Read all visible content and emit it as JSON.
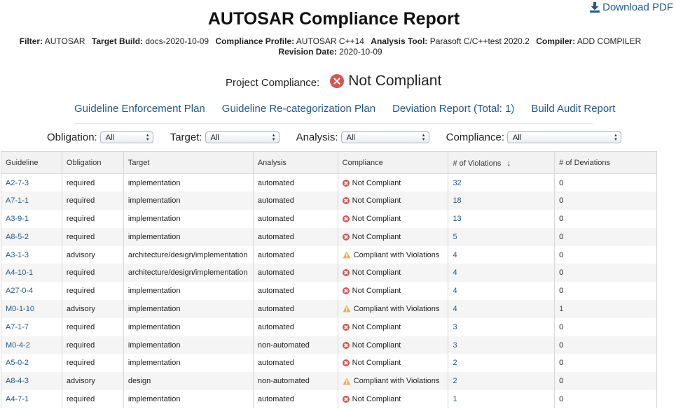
{
  "header": {
    "download_label": "Download PDF",
    "title": "AUTOSAR Compliance Report"
  },
  "meta": {
    "filter_label": "Filter:",
    "filter_value": "AUTOSAR",
    "build_label": "Target Build:",
    "build_value": "docs-2020-10-09",
    "profile_label": "Compliance Profile:",
    "profile_value": "AUTOSAR C++14",
    "tool_label": "Analysis Tool:",
    "tool_value": "Parasoft C/C++test 2020.2",
    "compiler_label": "Compiler:",
    "compiler_value": "ADD COMPILER",
    "revision_label": "Revision Date:",
    "revision_value": "2020-10-09"
  },
  "project": {
    "label": "Project Compliance:",
    "status": "Not Compliant",
    "status_color": "#d9534f"
  },
  "links": [
    "Guideline Enforcement Plan",
    "Guideline Re-categorization Plan",
    "Deviation Report (Total: 1)",
    "Build Audit Report"
  ],
  "filters": [
    {
      "label": "Obligation:",
      "value": "All"
    },
    {
      "label": "Target:",
      "value": "All"
    },
    {
      "label": "Analysis:",
      "value": "All"
    },
    {
      "label": "Compliance:",
      "value": "All"
    }
  ],
  "table": {
    "headers": [
      "Guideline",
      "Obligation",
      "Target",
      "Analysis",
      "Compliance",
      "# of Violations",
      "# of Deviations"
    ],
    "rows": [
      {
        "guideline": "A2-7-3",
        "obligation": "required",
        "target": "implementation",
        "analysis": "automated",
        "compliance": "Not Compliant",
        "status_icon": "error-icon",
        "violations": "32",
        "deviations": "0"
      },
      {
        "guideline": "A7-1-1",
        "obligation": "required",
        "target": "implementation",
        "analysis": "automated",
        "compliance": "Not Compliant",
        "status_icon": "error-icon",
        "violations": "18",
        "deviations": "0"
      },
      {
        "guideline": "A3-9-1",
        "obligation": "required",
        "target": "implementation",
        "analysis": "automated",
        "compliance": "Not Compliant",
        "status_icon": "error-icon",
        "violations": "13",
        "deviations": "0"
      },
      {
        "guideline": "A8-5-2",
        "obligation": "required",
        "target": "implementation",
        "analysis": "automated",
        "compliance": "Not Compliant",
        "status_icon": "error-icon",
        "violations": "5",
        "deviations": "0"
      },
      {
        "guideline": "A3-1-3",
        "obligation": "advisory",
        "target": "architecture/design/implementation",
        "analysis": "automated",
        "compliance": "Compliant with Violations",
        "status_icon": "warning-icon",
        "violations": "4",
        "deviations": "0"
      },
      {
        "guideline": "A4-10-1",
        "obligation": "required",
        "target": "architecture/design/implementation",
        "analysis": "automated",
        "compliance": "Not Compliant",
        "status_icon": "error-icon",
        "violations": "4",
        "deviations": "0"
      },
      {
        "guideline": "A27-0-4",
        "obligation": "required",
        "target": "implementation",
        "analysis": "automated",
        "compliance": "Not Compliant",
        "status_icon": "error-icon",
        "violations": "4",
        "deviations": "0"
      },
      {
        "guideline": "M0-1-10",
        "obligation": "advisory",
        "target": "implementation",
        "analysis": "automated",
        "compliance": "Compliant with Violations",
        "status_icon": "warning-icon",
        "violations": "4",
        "deviations": "1",
        "deviation_link": true
      },
      {
        "guideline": "A7-1-7",
        "obligation": "required",
        "target": "implementation",
        "analysis": "automated",
        "compliance": "Not Compliant",
        "status_icon": "error-icon",
        "violations": "3",
        "deviations": "0"
      },
      {
        "guideline": "M0-4-2",
        "obligation": "required",
        "target": "implementation",
        "analysis": "non-automated",
        "compliance": "Not Compliant",
        "status_icon": "error-icon",
        "violations": "3",
        "deviations": "0"
      },
      {
        "guideline": "A5-0-2",
        "obligation": "required",
        "target": "implementation",
        "analysis": "automated",
        "compliance": "Not Compliant",
        "status_icon": "error-icon",
        "violations": "2",
        "deviations": "0"
      },
      {
        "guideline": "A8-4-3",
        "obligation": "advisory",
        "target": "design",
        "analysis": "non-automated",
        "compliance": "Compliant with Violations",
        "status_icon": "warning-icon",
        "violations": "2",
        "deviations": "0"
      },
      {
        "guideline": "A4-7-1",
        "obligation": "required",
        "target": "implementation",
        "analysis": "automated",
        "compliance": "Not Compliant",
        "status_icon": "error-icon",
        "violations": "1",
        "deviations": "0"
      }
    ]
  }
}
